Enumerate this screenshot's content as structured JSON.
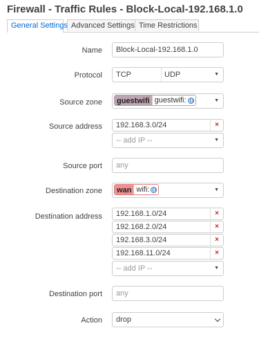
{
  "page_title": "Firewall - Traffic Rules - Block-Local-192.168.1.0",
  "tabs": [
    {
      "label": "General Settings"
    },
    {
      "label": "Advanced Settings"
    },
    {
      "label": "Time Restrictions"
    }
  ],
  "form": {
    "name": {
      "label": "Name",
      "value": "Block-Local-192.168.1.0"
    },
    "protocol": {
      "label": "Protocol",
      "values": [
        "TCP",
        "UDP"
      ]
    },
    "source_zone": {
      "label": "Source zone",
      "zone": "guestwifi",
      "network": "guestwifi:"
    },
    "source_address": {
      "label": "Source address",
      "entries": [
        "192.168.3.0/24"
      ],
      "add_placeholder": "-- add IP --"
    },
    "source_port": {
      "label": "Source port",
      "placeholder": "any"
    },
    "destination_zone": {
      "label": "Destination zone",
      "zone": "wan",
      "network": "wifi:"
    },
    "destination_address": {
      "label": "Destination address",
      "entries": [
        "192.168.1.0/24",
        "192.168.2.0/24",
        "192.168.3.0/24",
        "192.168.11.0/24"
      ],
      "add_placeholder": "-- add IP --"
    },
    "destination_port": {
      "label": "Destination port",
      "placeholder": "any"
    },
    "action": {
      "label": "Action",
      "value": "drop"
    }
  },
  "icons": {
    "remove": "×",
    "dropdown": "▼"
  },
  "colors": {
    "active_tab_text": "#0069d6",
    "guestwifi_zone": "#bfa5b2",
    "wan_zone": "#f09090",
    "remove_icon": "#cc2222"
  }
}
